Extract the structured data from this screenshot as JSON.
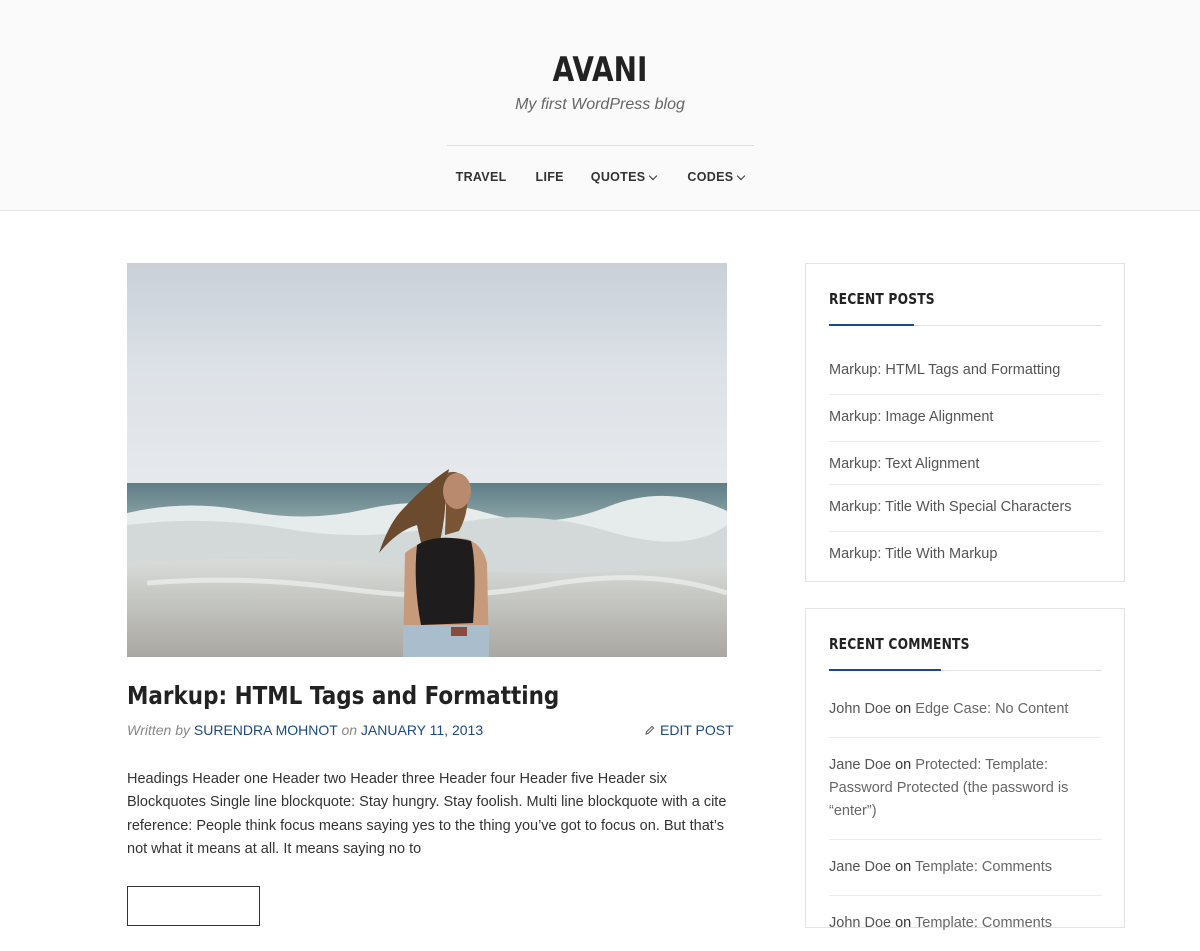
{
  "site": {
    "title": "AVANI",
    "tagline": "My first WordPress blog"
  },
  "nav": {
    "items": [
      {
        "label": "TRAVEL",
        "has_submenu": false
      },
      {
        "label": "LIFE",
        "has_submenu": false
      },
      {
        "label": "QUOTES",
        "has_submenu": true
      },
      {
        "label": "CODES",
        "has_submenu": true
      }
    ]
  },
  "post": {
    "title": "Markup: HTML Tags and Formatting",
    "meta": {
      "written_by": "Written by",
      "author": "SURENDRA MOHNOT",
      "on": "on",
      "date": "JANUARY 11, 2013"
    },
    "edit_label": "EDIT POST",
    "excerpt": "Headings Header one Header two Header three Header four Header five Header six Blockquotes Single line blockquote: Stay hungry. Stay foolish. Multi line blockquote with a cite reference: People think focus means saying yes to the thing you’ve got to focus on. But that’s not what it means at all. It means saying no to"
  },
  "sidebar": {
    "recent_posts": {
      "title": "RECENT POSTS",
      "items": [
        "Markup: HTML Tags and Formatting",
        "Markup: Image Alignment",
        "Markup: Text Alignment",
        "Markup: Title With Special Characters",
        "Markup: Title With Markup"
      ]
    },
    "recent_comments": {
      "title": "RECENT COMMENTS",
      "items": [
        {
          "author": "John Doe",
          "on": "on",
          "target": "Edge Case: No Content"
        },
        {
          "author": "Jane Doe",
          "on": "on",
          "target": "Protected: Template: Password Protected (the password is “enter”)"
        },
        {
          "author": "Jane Doe",
          "on": "on",
          "target": "Template: Comments"
        },
        {
          "author": "John Doe",
          "on": "on",
          "target": "Template: Comments"
        }
      ]
    }
  },
  "colors": {
    "accent": "#1b4a85",
    "header_bg": "#fafafa",
    "text": "#333333"
  }
}
